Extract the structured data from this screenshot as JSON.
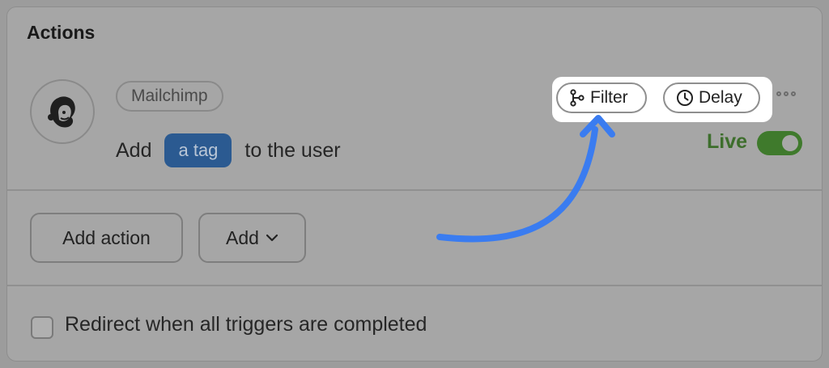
{
  "section": {
    "title": "Actions"
  },
  "action": {
    "service_name": "Mailchimp",
    "service_icon": "mailchimp-logo-icon",
    "sentence_prefix": "Add",
    "tag_chip": "a tag",
    "sentence_suffix": "to the user",
    "filter_label": "Filter",
    "filter_icon": "branch-icon",
    "delay_label": "Delay",
    "delay_icon": "clock-icon",
    "more_icon": "more-horizontal-icon",
    "status_label": "Live",
    "status_on": true
  },
  "footer_buttons": {
    "add_action_label": "Add action",
    "add_label": "Add",
    "add_icon": "chevron-down-icon"
  },
  "options": {
    "redirect_label": "Redirect when all triggers are completed",
    "redirect_checked": false
  },
  "colors": {
    "tag_chip_bg": "#2b5a91",
    "live_green": "#3f7a2c",
    "annotation_arrow": "#3a7cf0"
  }
}
